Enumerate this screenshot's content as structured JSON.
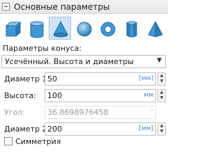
{
  "header": {
    "title": "Основные параметры"
  },
  "shapes": [
    {
      "name": "box-icon"
    },
    {
      "name": "cylinder-icon"
    },
    {
      "name": "cone-icon",
      "active": true
    },
    {
      "name": "sphere-icon"
    },
    {
      "name": "torus-icon"
    },
    {
      "name": "prism-icon"
    },
    {
      "name": "pyramid-icon"
    }
  ],
  "cone_params": {
    "label": "Параметры конуса:",
    "mode_value": "Усечённый. Высота и диаметры"
  },
  "fields": {
    "diameter1": {
      "label": "Диаметр 1:",
      "value": "50",
      "unit": "[мм]"
    },
    "height": {
      "label": "Высота:",
      "value": "100",
      "unit": "мм"
    },
    "angle": {
      "label": "Угол:",
      "value": "36.8698976458",
      "unit": "°"
    },
    "diameter2": {
      "label": "Диаметр 2:",
      "value": "200",
      "unit": "[мм]"
    }
  },
  "symmetry": {
    "label": "Симметрия",
    "checked": false
  },
  "colors": {
    "accent": "#4a86c8",
    "active_bg": "#cfe3f7"
  }
}
